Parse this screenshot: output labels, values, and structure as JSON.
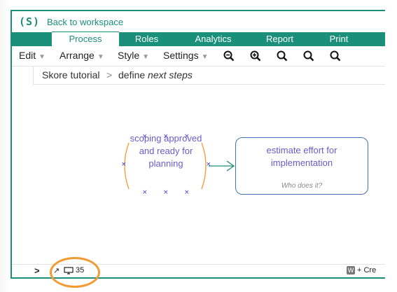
{
  "app": {
    "logo_text": "(S)",
    "back_link": "Back to workspace"
  },
  "tabs": [
    {
      "label": "Process",
      "active": true
    },
    {
      "label": "Roles",
      "active": false
    },
    {
      "label": "Analytics",
      "active": false
    },
    {
      "label": "Report",
      "active": false
    },
    {
      "label": "Print",
      "active": false
    }
  ],
  "menus": [
    {
      "label": "Edit"
    },
    {
      "label": "Arrange"
    },
    {
      "label": "Style"
    },
    {
      "label": "Settings"
    }
  ],
  "zoom_icons": [
    "zoom-out-icon",
    "zoom-in-icon",
    "zoom-fit-icon",
    "zoom-actual-icon",
    "search-icon"
  ],
  "breadcrumb": {
    "root": "Skore tutorial",
    "separator": ">",
    "prefix": "define",
    "current": "next steps"
  },
  "diagram": {
    "node_a": {
      "lines": [
        "scoping approved",
        "and ready for",
        "planning"
      ]
    },
    "node_b": {
      "title_lines": [
        "estimate effort for",
        "implementation"
      ],
      "subtitle": "Who does it?"
    }
  },
  "status": {
    "count": "35",
    "key_hint": "W",
    "hint_text": "+ Cre"
  },
  "colors": {
    "brand": "#1a8f7a",
    "node_text": "#6a5acd",
    "highlight": "#f39a33"
  }
}
